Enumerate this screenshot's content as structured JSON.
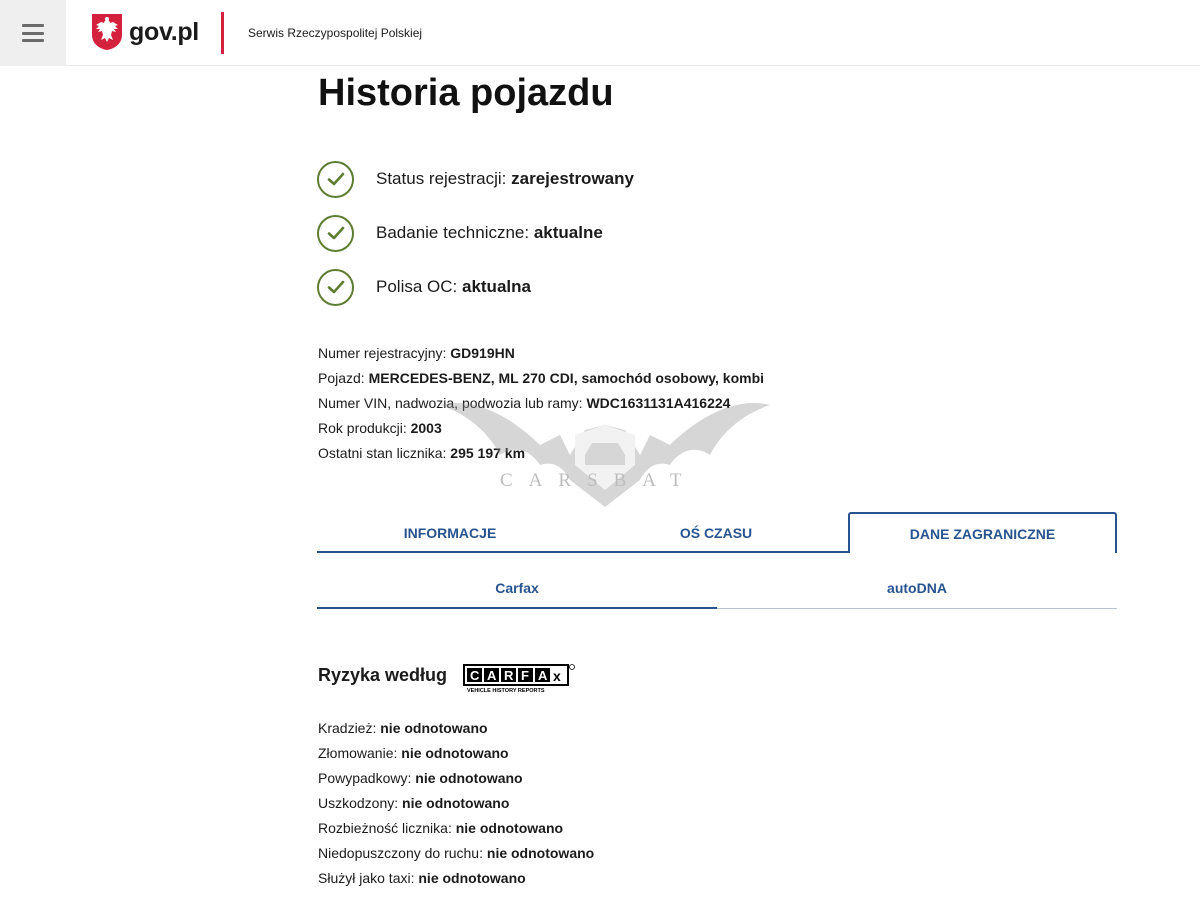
{
  "header": {
    "logo_text": "gov.pl",
    "service_name": "Serwis Rzeczypospolitej Polskiej",
    "menu_icon": "hamburger-menu-icon",
    "emblem_icon": "polish-eagle-emblem"
  },
  "page_title": "Historia pojazdu",
  "statuses": [
    {
      "label": "Status rejestracji:",
      "value": "zarejestrowany"
    },
    {
      "label": "Badanie techniczne:",
      "value": "aktualne"
    },
    {
      "label": "Polisa OC:",
      "value": "aktualna"
    }
  ],
  "vehicle": {
    "registration": {
      "label": "Numer rejestracyjny:",
      "value": "GD919HN"
    },
    "vehicle": {
      "label": "Pojazd:",
      "value": "MERCEDES-BENZ, ML 270 CDI, samochód osobowy, kombi"
    },
    "vin": {
      "label": "Numer VIN, nadwozia, podwozia lub ramy:",
      "value": "WDC1631131A416224"
    },
    "year": {
      "label": "Rok produkcji:",
      "value": "2003"
    },
    "mileage": {
      "label": "Ostatni stan licznika:",
      "value": "295 197 km"
    }
  },
  "watermark": "CARSBAT",
  "tabs": [
    {
      "label": "INFORMACJE",
      "active": false
    },
    {
      "label": "OŚ CZASU",
      "active": false
    },
    {
      "label": "DANE ZAGRANICZNE",
      "active": true
    }
  ],
  "subtabs": [
    {
      "label": "Carfax",
      "active": true
    },
    {
      "label": "autoDNA",
      "active": false
    }
  ],
  "risk_section": {
    "title": "Ryzyka według",
    "logo_text": "CARFAX",
    "logo_subtitle": "VEHICLE HISTORY REPORTS",
    "items": [
      {
        "label": "Kradzież:",
        "value": "nie odnotowano"
      },
      {
        "label": "Złomowanie:",
        "value": "nie odnotowano"
      },
      {
        "label": "Powypadkowy:",
        "value": "nie odnotowano"
      },
      {
        "label": "Uszkodzony:",
        "value": "nie odnotowano"
      },
      {
        "label": "Rozbieżność licznika:",
        "value": "nie odnotowano"
      },
      {
        "label": "Niedopuszczony do ruchu:",
        "value": "nie odnotowano"
      },
      {
        "label": "Służył jako taxi:",
        "value": "nie odnotowano"
      }
    ]
  },
  "colors": {
    "accent": "#27548f",
    "check_green": "#5f7d32",
    "brand_red": "#d4213d"
  }
}
